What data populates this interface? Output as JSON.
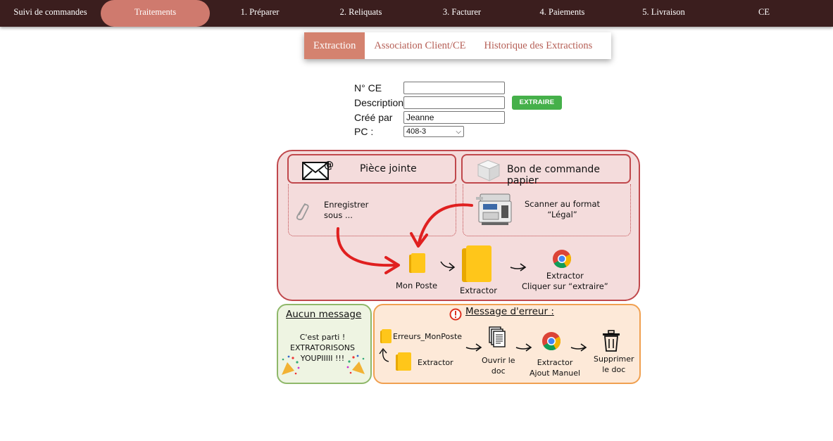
{
  "nav": {
    "items": [
      "Suivi de commandes",
      "Traitements",
      "1. Préparer",
      "2. Reliquats",
      "3. Facturer",
      "4. Paiements",
      "5. Livraison",
      "CE"
    ],
    "active_index": 1
  },
  "tabs": [
    "Extraction",
    "Association Client/CE",
    "Historique des Extractions"
  ],
  "form": {
    "ce_label": "N° CE",
    "ce_value": "",
    "description_label": "Description",
    "description_value": "",
    "created_by_label": "Créé par",
    "created_by_value": "Jeanne",
    "pc_label": "PC :",
    "pc_value": "408-3",
    "extract_button": "EXTRAIRE"
  },
  "diagram": {
    "attachment_title": "Pièce jointe",
    "paper_title": "Bon de commande papier",
    "save_as": [
      "Enregistrer",
      "sous ..."
    ],
    "scan_text": [
      "Scanner au format",
      "“Légal”"
    ],
    "mon_poste": "Mon Poste",
    "extractor": "Extractor",
    "extractor_click": [
      "Extractor",
      "Cliquer sur “extraire”"
    ]
  },
  "success": {
    "title": "Aucun message",
    "lines": [
      "C'est parti !",
      "EXTRATORISONS",
      "YOUPIIIII !!!"
    ]
  },
  "error": {
    "title": "Message d'erreur :",
    "errors_folder": "Erreurs_MonPoste",
    "extractor": "Extractor",
    "open_doc": [
      "Ouvrir le",
      "doc"
    ],
    "manual_add": [
      "Extractor",
      "Ajout Manuel"
    ],
    "delete_doc": [
      "Supprimer",
      "le doc"
    ]
  },
  "colors": {
    "nav_bg": "#3b1e1e",
    "accent": "#cf7a6e",
    "extract_green": "#45b04a",
    "main_panel_border": "#c0484c",
    "ok_border": "#8fb86a",
    "err_border": "#f0a050"
  }
}
